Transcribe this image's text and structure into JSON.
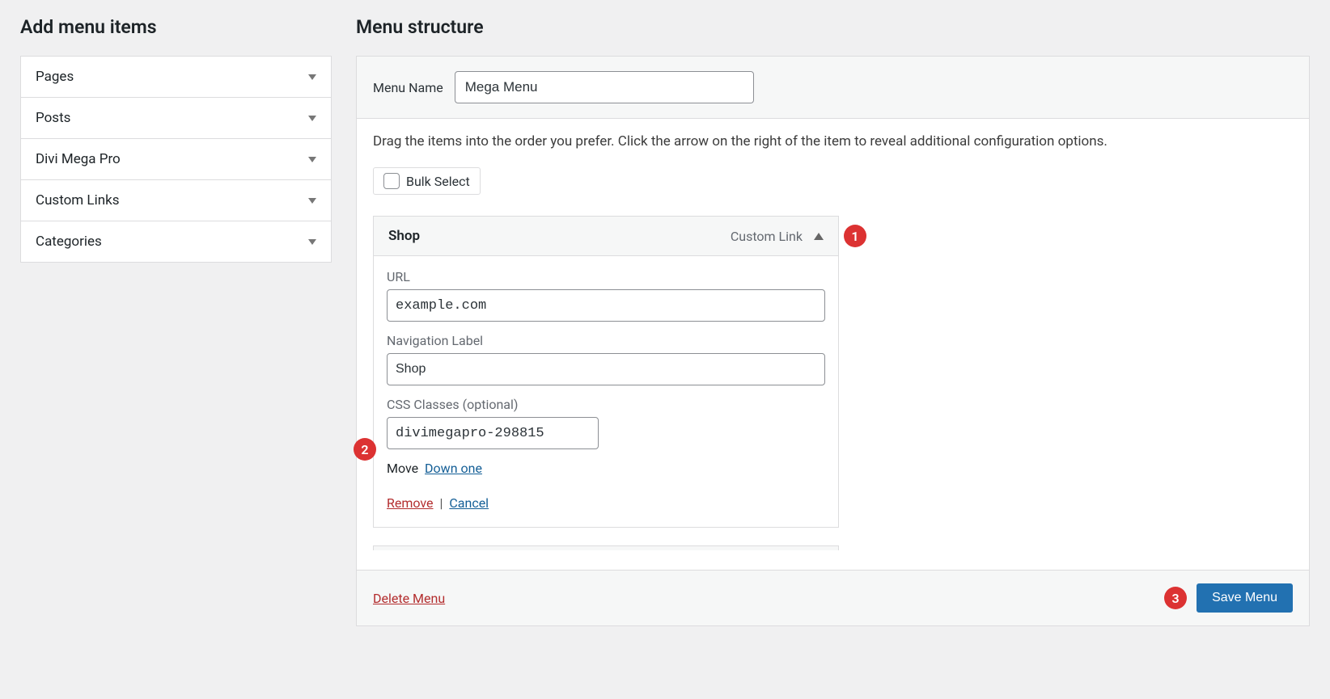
{
  "left": {
    "heading": "Add menu items",
    "items": [
      "Pages",
      "Posts",
      "Divi Mega Pro",
      "Custom Links",
      "Categories"
    ]
  },
  "right": {
    "heading": "Menu structure",
    "menu_name_label": "Menu Name",
    "menu_name_value": "Mega Menu",
    "instructions": "Drag the items into the order you prefer. Click the arrow on the right of the item to reveal additional configuration options.",
    "bulk_select_label": "Bulk Select",
    "item": {
      "title": "Shop",
      "type": "Custom Link",
      "url_label": "URL",
      "url_value": "example.com",
      "nav_label_label": "Navigation Label",
      "nav_label_value": "Shop",
      "css_label": "CSS Classes (optional)",
      "css_value": "divimegapro-298815",
      "move_label": "Move",
      "move_down": "Down one",
      "remove": "Remove",
      "cancel": "Cancel"
    },
    "footer": {
      "delete_label": "Delete Menu",
      "save_label": "Save Menu"
    }
  },
  "annotations": {
    "a1": "1",
    "a2": "2",
    "a3": "3"
  }
}
